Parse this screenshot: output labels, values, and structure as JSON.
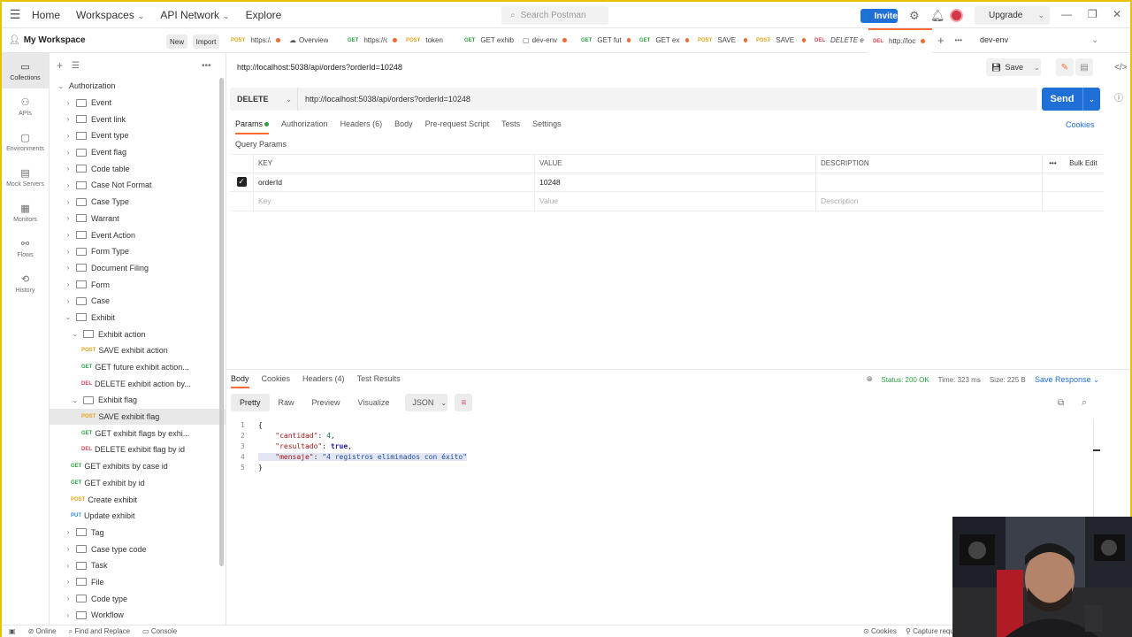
{
  "topbar": {
    "nav": [
      "Home",
      "Workspaces",
      "API Network",
      "Explore"
    ],
    "search_placeholder": "Search Postman",
    "invite_label": "Invite",
    "upgrade_label": "Upgrade"
  },
  "workspace": {
    "name": "My Workspace",
    "new_label": "New",
    "import_label": "Import"
  },
  "rail": [
    {
      "icon": "collections-icon",
      "label": "Collections"
    },
    {
      "icon": "apis-icon",
      "label": "APIs"
    },
    {
      "icon": "environments-icon",
      "label": "Environments"
    },
    {
      "icon": "mock-servers-icon",
      "label": "Mock Servers"
    },
    {
      "icon": "monitors-icon",
      "label": "Monitors"
    },
    {
      "icon": "flows-icon",
      "label": "Flows"
    },
    {
      "icon": "history-icon",
      "label": "History"
    }
  ],
  "tree": [
    {
      "label": "Authorization",
      "type": "collection",
      "indent": 0,
      "expanded": true
    },
    {
      "label": "Event",
      "type": "folder",
      "indent": 1
    },
    {
      "label": "Event link",
      "type": "folder",
      "indent": 1
    },
    {
      "label": "Event type",
      "type": "folder",
      "indent": 1
    },
    {
      "label": "Event flag",
      "type": "folder",
      "indent": 1
    },
    {
      "label": "Code table",
      "type": "folder",
      "indent": 1
    },
    {
      "label": "Case Not Format",
      "type": "folder",
      "indent": 1
    },
    {
      "label": "Case Type",
      "type": "folder",
      "indent": 1
    },
    {
      "label": "Warrant",
      "type": "folder",
      "indent": 1
    },
    {
      "label": "Event Action",
      "type": "folder",
      "indent": 1
    },
    {
      "label": "Form Type",
      "type": "folder",
      "indent": 1
    },
    {
      "label": "Document Filing",
      "type": "folder",
      "indent": 1
    },
    {
      "label": "Form",
      "type": "folder",
      "indent": 1
    },
    {
      "label": "Case",
      "type": "folder",
      "indent": 1
    },
    {
      "label": "Exhibit",
      "type": "folder",
      "indent": 1,
      "expanded": true
    },
    {
      "label": "Exhibit action",
      "type": "folder",
      "indent": 2,
      "expanded": true
    },
    {
      "label": "SAVE exhibit action",
      "type": "request",
      "method": "POST",
      "indent": 3
    },
    {
      "label": "GET future exhibit action...",
      "type": "request",
      "method": "GET",
      "indent": 3
    },
    {
      "label": "DELETE exhibit action by...",
      "type": "request",
      "method": "DEL",
      "indent": 3
    },
    {
      "label": "Exhibit flag",
      "type": "folder",
      "indent": 2,
      "expanded": true
    },
    {
      "label": "SAVE exhibit flag",
      "type": "request",
      "method": "POST",
      "indent": 3,
      "selected": true
    },
    {
      "label": "GET exhibit flags by exhi...",
      "type": "request",
      "method": "GET",
      "indent": 3
    },
    {
      "label": "DELETE exhibit flag by id",
      "type": "request",
      "method": "DEL",
      "indent": 3
    },
    {
      "label": "GET exhibits by case id",
      "type": "request",
      "method": "GET",
      "indent": 2
    },
    {
      "label": "GET exhibit by id",
      "type": "request",
      "method": "GET",
      "indent": 2
    },
    {
      "label": "Create exhibit",
      "type": "request",
      "method": "POST",
      "indent": 2
    },
    {
      "label": "Update exhibit",
      "type": "request",
      "method": "PUT",
      "indent": 2
    },
    {
      "label": "Tag",
      "type": "folder",
      "indent": 1
    },
    {
      "label": "Case type code",
      "type": "folder",
      "indent": 1
    },
    {
      "label": "Task",
      "type": "folder",
      "indent": 1
    },
    {
      "label": "File",
      "type": "folder",
      "indent": 1
    },
    {
      "label": "Code type",
      "type": "folder",
      "indent": 1
    },
    {
      "label": "Workflow",
      "type": "folder",
      "indent": 1
    }
  ],
  "tabs": [
    {
      "method": "POST",
      "label": "https://",
      "dot": true
    },
    {
      "method": "",
      "label": "Overview",
      "icon": true
    },
    {
      "method": "GET",
      "label": "https://c",
      "dot": true
    },
    {
      "method": "POST",
      "label": "token",
      "dot": false
    },
    {
      "method": "GET",
      "label": "GET exhib",
      "dot": false
    },
    {
      "method": "",
      "label": "dev-env",
      "icon": true,
      "dot": true
    },
    {
      "method": "GET",
      "label": "GET futu",
      "dot": true
    },
    {
      "method": "GET",
      "label": "GET exhi",
      "dot": true
    },
    {
      "method": "POST",
      "label": "SAVE e",
      "dot": true
    },
    {
      "method": "POST",
      "label": "SAVE e",
      "dot": true
    },
    {
      "method": "DEL",
      "label": "DELETE e",
      "dot": false
    },
    {
      "method": "DEL",
      "label": "http://loc",
      "dot": true,
      "active": true
    }
  ],
  "environment": "dev-env",
  "request": {
    "title": "http://localhost:5038/api/orders?orderId=10248",
    "save_label": "Save",
    "method": "DELETE",
    "url": "http://localhost:5038/api/orders?orderId=10248",
    "send_label": "Send",
    "subtabs": [
      "Params",
      "Authorization",
      "Headers (6)",
      "Body",
      "Pre-request Script",
      "Tests",
      "Settings"
    ],
    "cookies_label": "Cookies",
    "query_params_label": "Query Params",
    "table_headers": [
      "KEY",
      "VALUE",
      "DESCRIPTION"
    ],
    "bulk_edit": "Bulk Edit",
    "params": [
      {
        "key": "orderId",
        "value": "10248",
        "description": ""
      }
    ],
    "placeholders": {
      "key": "Key",
      "value": "Value",
      "description": "Description"
    }
  },
  "response": {
    "tabs": [
      "Body",
      "Cookies",
      "Headers (4)",
      "Test Results"
    ],
    "status": "Status: 200 OK",
    "time": "Time: 323 ms",
    "size": "Size: 225 B",
    "save_response": "Save Response",
    "formats": [
      "Pretty",
      "Raw",
      "Preview",
      "Visualize"
    ],
    "format_type": "JSON",
    "body_lines": [
      "{",
      "    \"cantidad\": 4,",
      "    \"resultado\": true,",
      "    \"mensaje\": \"4 registros eliminados con éxito\"",
      "}"
    ]
  },
  "statusbar": {
    "online": "Online",
    "find_replace": "Find and Replace",
    "console": "Console",
    "cookies": "Cookies",
    "capture": "Capture requ"
  },
  "colors": {
    "accent": "#ff6c37",
    "primary": "#1f6fd6",
    "post": "#e8a21c",
    "get": "#2ea043",
    "delete": "#d1495b"
  }
}
